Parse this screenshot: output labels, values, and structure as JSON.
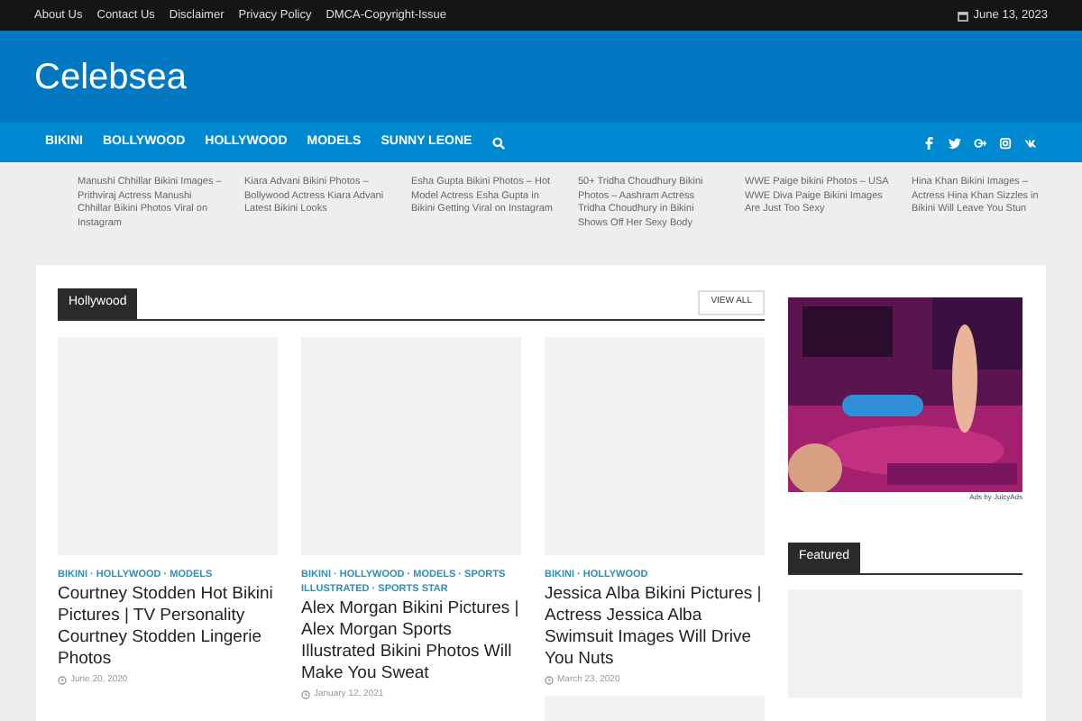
{
  "top_links": [
    "About Us",
    "Contact Us",
    "Disclaimer",
    "Privacy Policy",
    "DMCA-Copyright-Issue"
  ],
  "date": "June 13, 2023",
  "site_title": "Celebsea",
  "nav": [
    "BIKINI",
    "BOLLYWOOD",
    "HOLLYWOOD",
    "MODELS",
    "SUNNY LEONE"
  ],
  "ticker": [
    "Manushi Chhillar Bikini Images – Prithviraj Actress Manushi Chhillar Bikini Photos Viral on Instagram",
    "Kiara Advani Bikini Photos – Bollywood Actress Kiara Advani Latest Bikini Looks",
    "Esha Gupta Bikini Photos – Hot Model Actress Esha Gupta in Bikini Getting Viral on Instagram",
    "50+ Tridha Choudhury Bikini Photos – Aashram Actress Tridha Choudhury in Bikini Shows Off Her Sexy Body",
    "WWE Paige bikini Photos – USA WWE Diva Paige Bikini Images Are Just Too Sexy",
    "Hina Khan Bikini Images – Actress Hina Khan Sizzles in Bikini Will Leave You Stun"
  ],
  "section": {
    "title": "Hollywood",
    "view_all": "VIEW ALL"
  },
  "posts": [
    {
      "categories": "BIKINI · HOLLYWOOD · MODELS",
      "title": "Courtney Stodden Hot Bikini Pictures | TV Personality Courtney Stodden Lingerie Photos",
      "date": "June 20, 2020"
    },
    {
      "categories": "BIKINI · HOLLYWOOD · MODELS · SPORTS ILLUSTRATED · SPORTS STAR",
      "title": "Alex Morgan Bikini Pictures | Alex Morgan Sports Illustrated Bikini Photos Will Make You Sweat",
      "date": "January 12, 2021"
    },
    {
      "categories": "BIKINI · HOLLYWOOD",
      "title": "Jessica Alba Bikini Pictures | Actress Jessica Alba Swimsuit Images Will Drive You Nuts",
      "date": "March 23, 2020"
    }
  ],
  "ad_credit": "Ads by JuicyAds",
  "sidebar_section": {
    "title": "Featured"
  }
}
